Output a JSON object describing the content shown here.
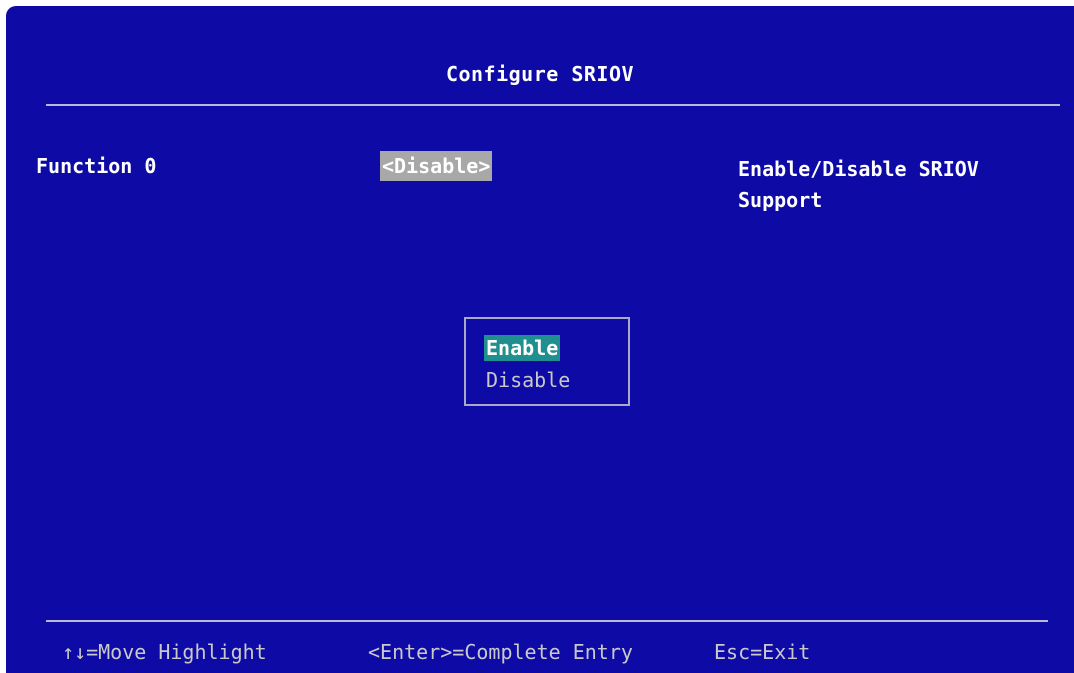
{
  "screen": {
    "title": "Configure SRIOV",
    "setting": {
      "label": "Function 0",
      "value": "<Disable>"
    },
    "help_text": "Enable/Disable SRIOV Support",
    "popup": {
      "options": [
        {
          "label": "Enable",
          "highlighted": true
        },
        {
          "label": "Disable",
          "highlighted": false
        }
      ]
    },
    "footer": {
      "move": "↑↓=Move Highlight",
      "complete": "<Enter>=Complete Entry",
      "exit": "Esc=Exit"
    }
  },
  "colors": {
    "background": "#0e0aa6",
    "selected_value_bg": "#a8a8a8",
    "highlight_option_bg": "#1f8f8f",
    "text": "#ffffff",
    "dim_text": "#c9c9c9"
  }
}
